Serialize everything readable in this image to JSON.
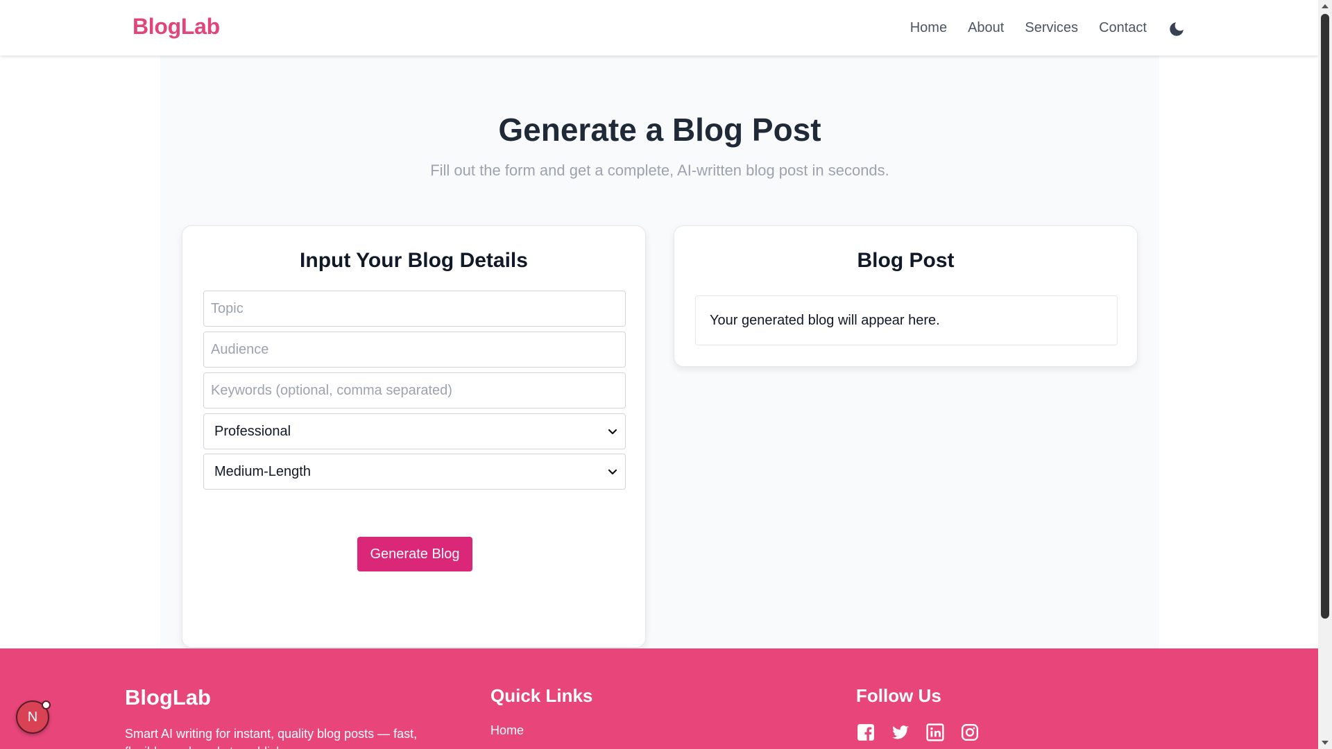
{
  "nav": {
    "logo": "BlogLab",
    "links": [
      "Home",
      "About",
      "Services",
      "Contact"
    ],
    "theme_icon": "moon-icon"
  },
  "hero": {
    "title": "Generate a Blog Post",
    "subtitle": "Fill out the form and get a complete, AI-written blog post in seconds."
  },
  "form": {
    "title": "Input Your Blog Details",
    "topic_placeholder": "Topic",
    "audience_placeholder": "Audience",
    "keywords_placeholder": "Keywords (optional, comma separated)",
    "tone_selected": "Professional",
    "length_selected": "Medium-Length",
    "generate_label": "Generate Blog"
  },
  "output": {
    "title": "Blog Post",
    "placeholder_text": "Your generated blog will appear here."
  },
  "footer": {
    "brand": "BlogLab",
    "description": "Smart AI writing for instant, quality blog posts — fast, flexible, and ready to publish.",
    "quick_links_title": "Quick Links",
    "quick_links": [
      "Home"
    ],
    "follow_title": "Follow Us",
    "social_icons": [
      "facebook-icon",
      "twitter-icon",
      "linkedin-icon",
      "instagram-icon"
    ]
  },
  "badge": {
    "letter": "N"
  },
  "colors": {
    "brand_pink": "#e2457a",
    "button_pink": "#db2777",
    "footer_pink": "#e8467a"
  }
}
